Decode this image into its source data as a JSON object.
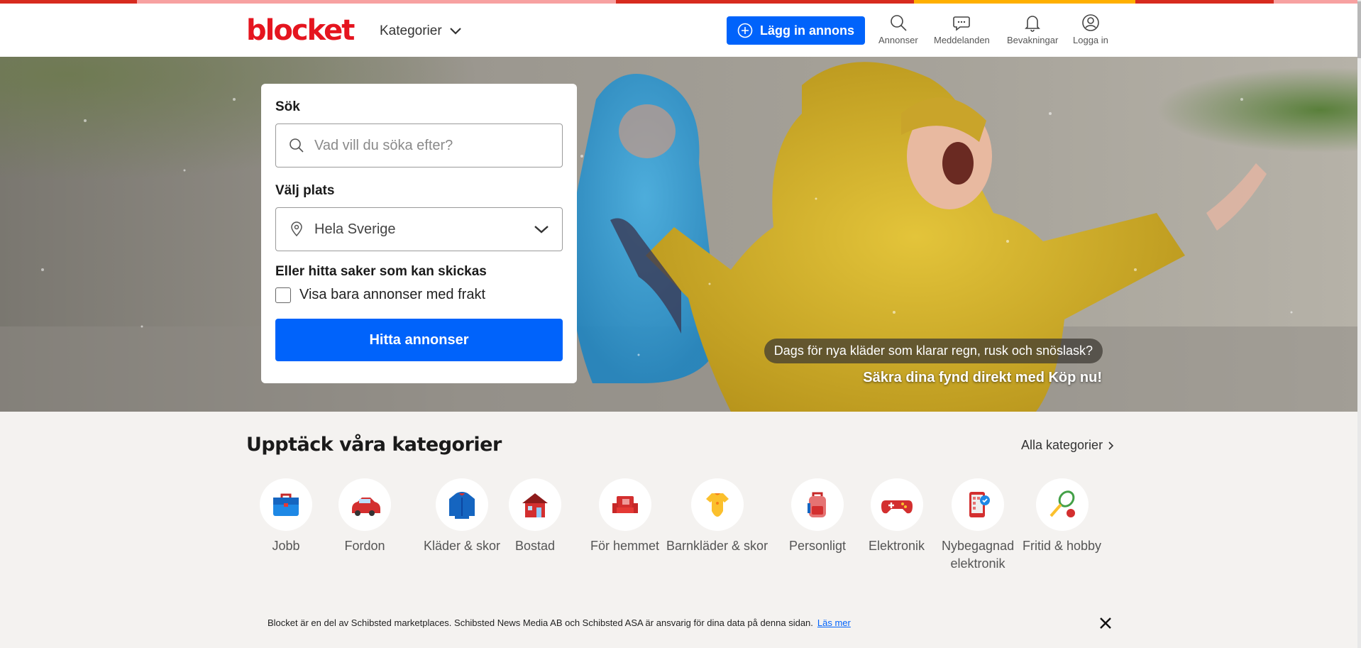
{
  "colors": {
    "brand_red": "#e5151f",
    "primary_blue": "#0063fb",
    "stripe": [
      "#d72b1f",
      "#f7a1a1",
      "#d72b1f",
      "#ffb000",
      "#d72b1f",
      "#f7a1a1"
    ]
  },
  "header": {
    "logo": "blocket",
    "categories_label": "Kategorier",
    "post_ad_label": "Lägg in annons",
    "nav": [
      {
        "label": "Annonser",
        "icon": "search-icon"
      },
      {
        "label": "Meddelanden",
        "icon": "chat-bubble-icon"
      },
      {
        "label": "Bevakningar",
        "icon": "bell-icon"
      },
      {
        "label": "Logga in",
        "icon": "user-icon"
      }
    ]
  },
  "search": {
    "title": "Sök",
    "placeholder": "Vad vill du söka efter?",
    "location_title": "Välj plats",
    "location_value": "Hela Sverige",
    "shipping_title": "Eller hitta saker som kan skickas",
    "shipping_checkbox_label": "Visa bara annonser med frakt",
    "shipping_checked": false,
    "submit_label": "Hitta annonser"
  },
  "hero": {
    "promo_question": "Dags för nya kläder som klarar regn, rusk och snöslask?",
    "promo_cta": "Säkra dina fynd direkt med Köp nu!"
  },
  "categories": {
    "title": "Upptäck våra kategorier",
    "all_label": "Alla kategorier",
    "items": [
      {
        "label": "Jobb",
        "icon": "briefcase-icon"
      },
      {
        "label": "Fordon",
        "icon": "car-icon"
      },
      {
        "label": "Kläder & skor",
        "icon": "jacket-icon"
      },
      {
        "label": "Bostad",
        "icon": "house-icon"
      },
      {
        "label": "För hemmet",
        "icon": "armchair-icon"
      },
      {
        "label": "Barnkläder & skor",
        "icon": "baby-bodysuit-icon"
      },
      {
        "label": "Personligt",
        "icon": "backpack-icon"
      },
      {
        "label": "Elektronik",
        "icon": "gamepad-icon"
      },
      {
        "label": "Nybegagnad",
        "label2": "elektronik",
        "icon": "phone-verified-icon"
      },
      {
        "label": "Fritid & hobby",
        "icon": "racket-ball-icon"
      }
    ]
  },
  "notice": {
    "text": "Blocket är en del av Schibsted marketplaces. Schibsted News Media AB och Schibsted ASA är ansvarig för dina data på denna sidan.",
    "link": "Läs mer"
  }
}
